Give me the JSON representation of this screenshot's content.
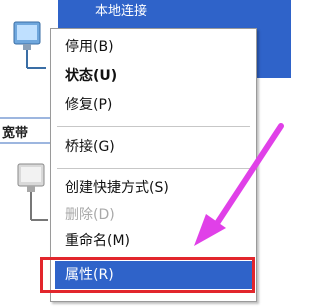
{
  "background": {
    "top_title": "本地连接",
    "section_label": "宽带"
  },
  "menu": {
    "items": [
      {
        "label": "停用(B)",
        "state": "normal"
      },
      {
        "label": "状态(U)",
        "state": "default"
      },
      {
        "label": "修复(P)",
        "state": "normal"
      },
      {
        "label": "桥接(G)",
        "state": "normal"
      },
      {
        "label": "创建快捷方式(S)",
        "state": "normal"
      },
      {
        "label": "删除(D)",
        "state": "disabled"
      },
      {
        "label": "重命名(M)",
        "state": "normal"
      },
      {
        "label": "属性(R)",
        "state": "highlighted"
      }
    ]
  },
  "colors": {
    "selection_blue": "#2f63c9",
    "annotation_red": "#e2262c",
    "annotation_magenta": "#e040e8"
  },
  "icons": [
    "network-connection-icon",
    "network-connection-icon"
  ]
}
